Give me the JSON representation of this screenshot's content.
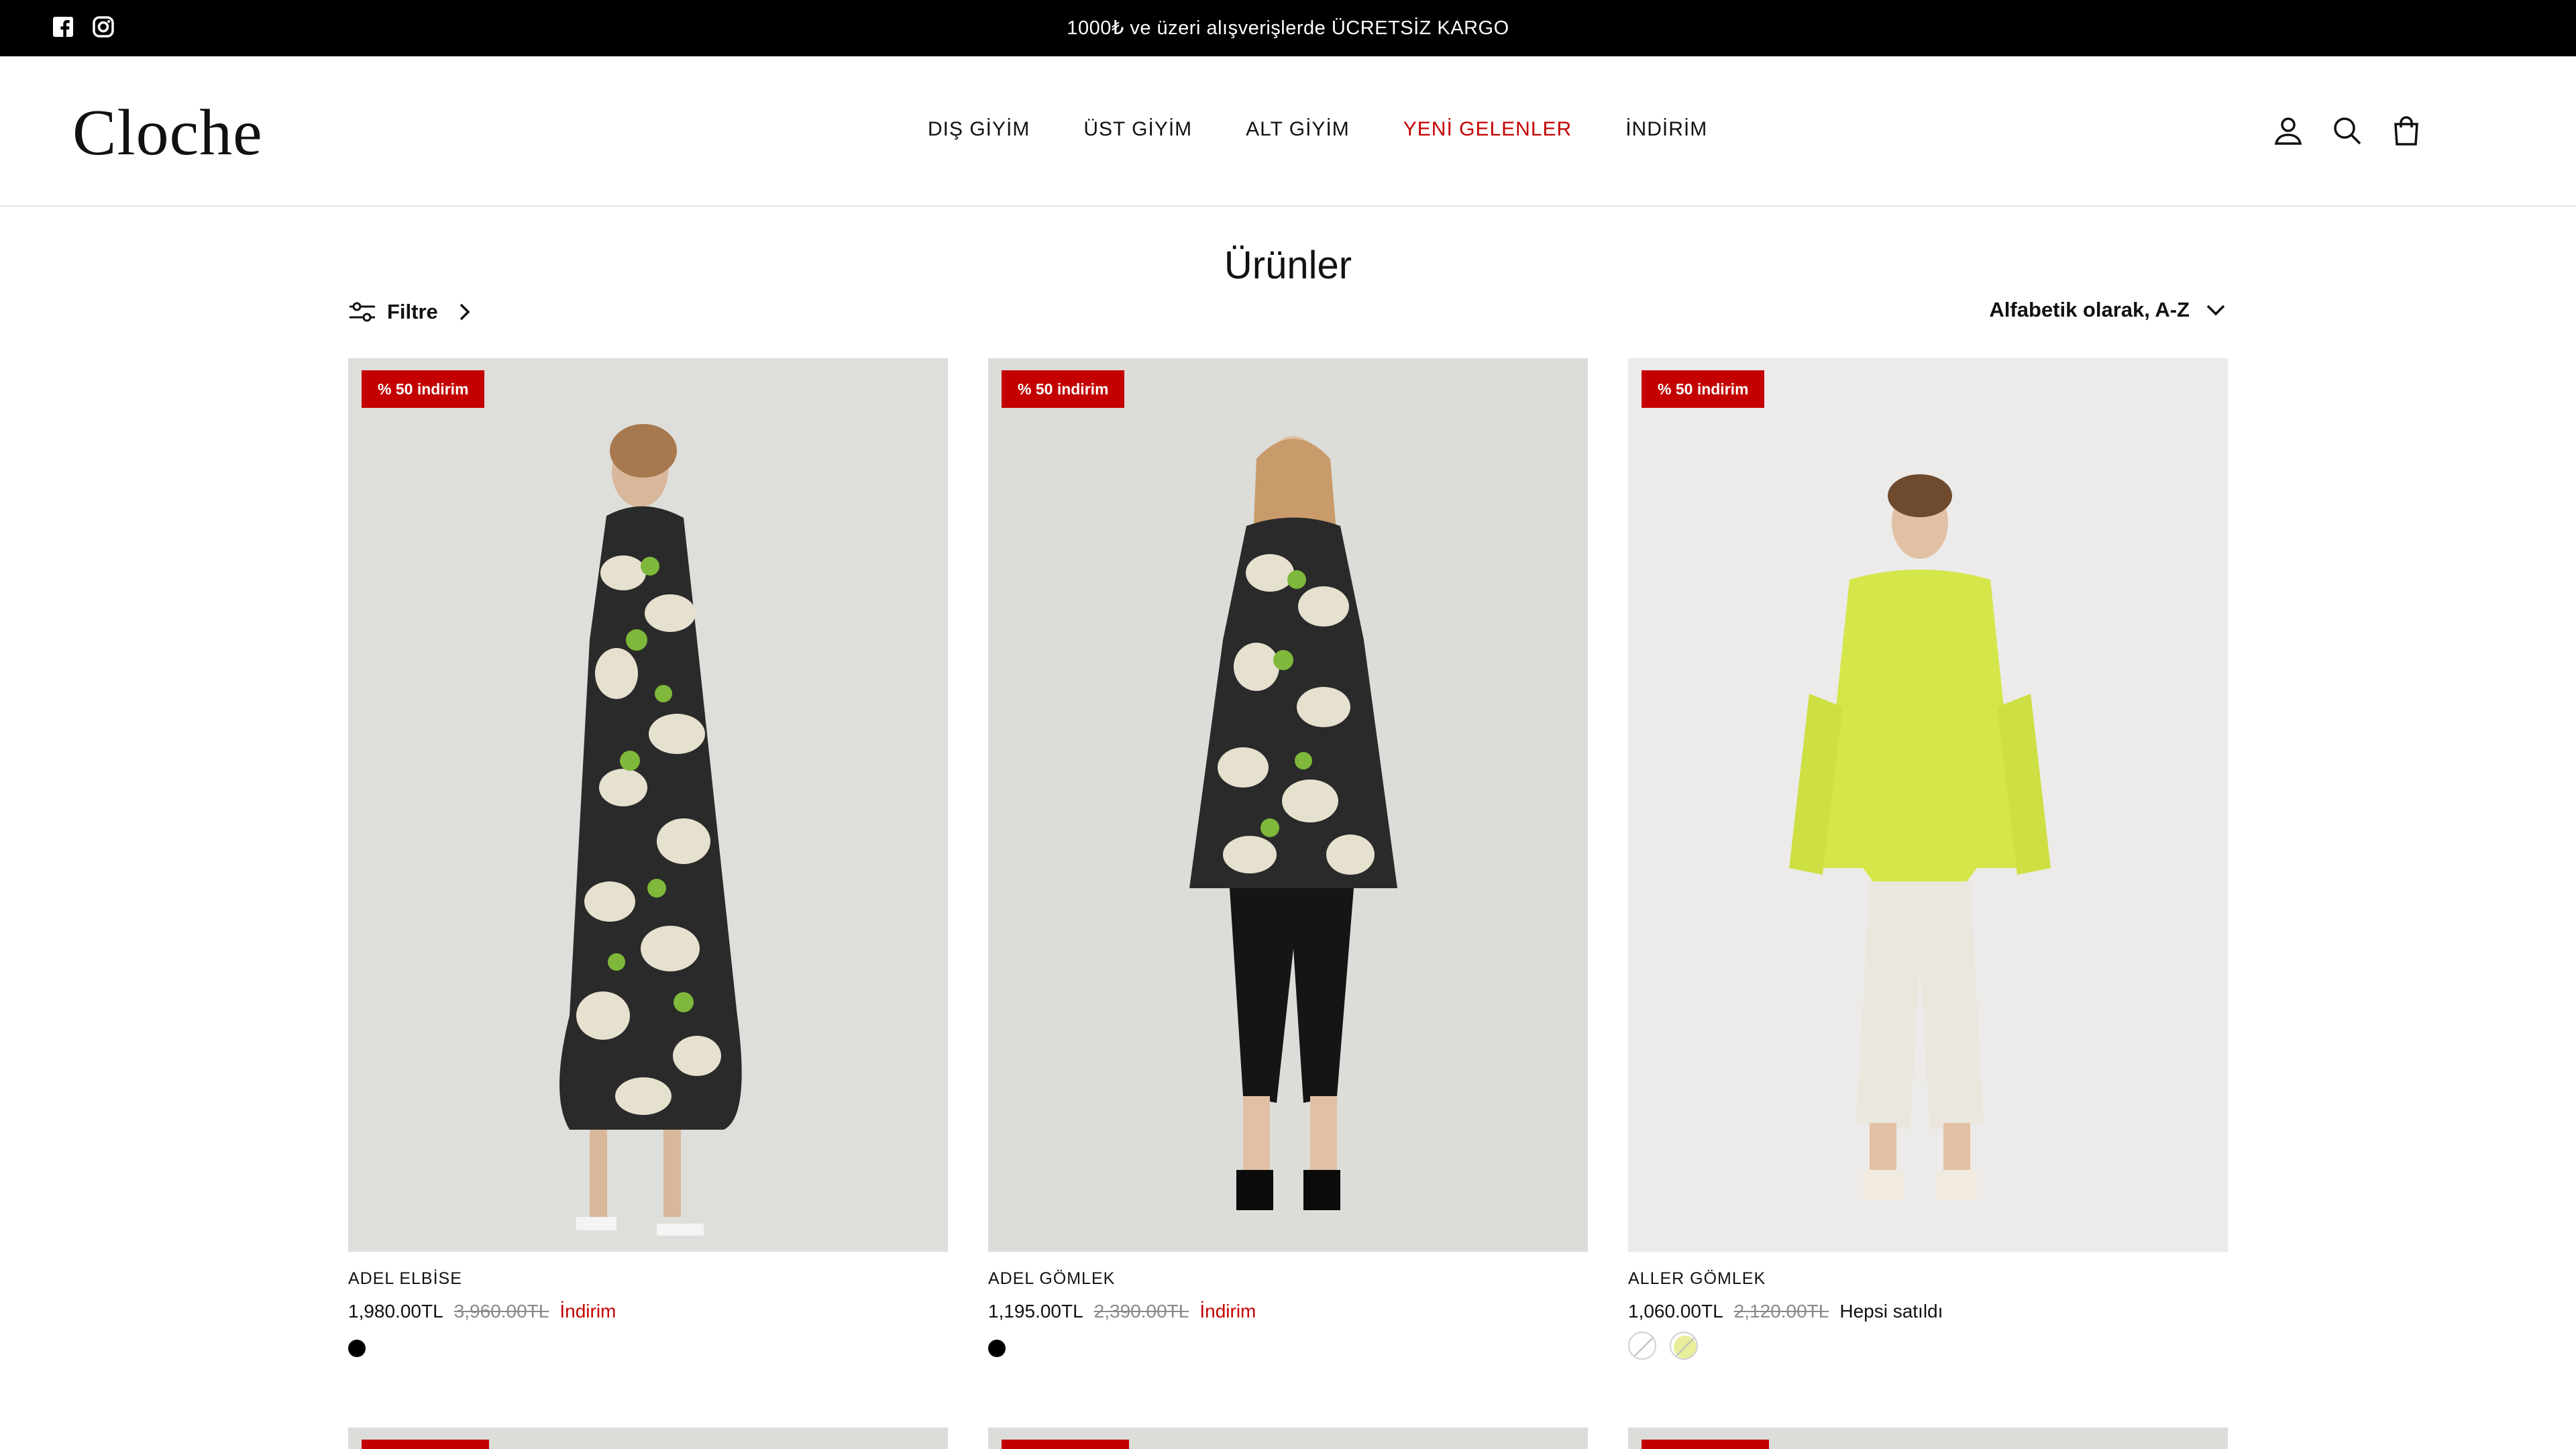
{
  "announcement": {
    "message": "1000₺ ve üzeri alışverişlerde ÜCRETSİZ KARGO",
    "social_icons": [
      "facebook-icon",
      "instagram-icon"
    ]
  },
  "header": {
    "logo": "Cloche",
    "nav": [
      {
        "label": "DIŞ GİYİM",
        "active": false
      },
      {
        "label": "ÜST GİYİM",
        "active": false
      },
      {
        "label": "ALT GİYİM",
        "active": false
      },
      {
        "label": "YENİ GELENLER",
        "active": true
      },
      {
        "label": "İNDİRİM",
        "active": false
      }
    ],
    "icons": [
      "account-icon",
      "search-icon",
      "cart-icon"
    ]
  },
  "page": {
    "title": "Ürünler",
    "filter_label": "Filtre",
    "sort_label": "Alfabetik olarak, A-Z"
  },
  "colors": {
    "accent_red": "#c40000",
    "announcement_bg": "#000000"
  },
  "products": [
    {
      "badge": "% 50 indirim",
      "name": "ADEL ELBİSE",
      "price": "1,980.00TL",
      "old_price": "3,960.00TL",
      "status": "İndirim",
      "swatches": [
        "#000000"
      ]
    },
    {
      "badge": "% 50 indirim",
      "name": "ADEL GÖMLEK",
      "price": "1,195.00TL",
      "old_price": "2,390.00TL",
      "status": "İndirim",
      "swatches": [
        "#000000"
      ]
    },
    {
      "badge": "% 50 indirim",
      "name": "ALLER GÖMLEK",
      "price": "1,060.00TL",
      "old_price": "2,120.00TL",
      "status": "Hepsi satıldı",
      "swatches": [
        "sold-out-white",
        "sold-out-lime"
      ]
    }
  ]
}
